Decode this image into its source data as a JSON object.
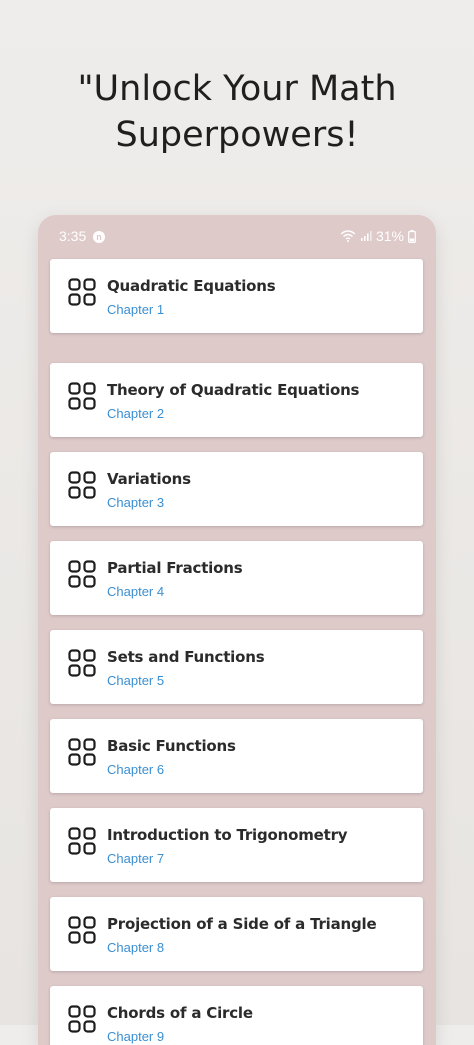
{
  "headline": {
    "line1": "\"Unlock Your Math",
    "line2": "Superpowers!"
  },
  "status": {
    "time": "3:35",
    "app_badge": "n",
    "battery": "31%"
  },
  "chapters": [
    {
      "title": "Quadratic Equations",
      "chapter": "Chapter 1"
    },
    {
      "title": "Theory of Quadratic Equations",
      "chapter": "Chapter 2"
    },
    {
      "title": "Variations",
      "chapter": "Chapter 3"
    },
    {
      "title": "Partial Fractions",
      "chapter": "Chapter 4"
    },
    {
      "title": "Sets and Functions",
      "chapter": "Chapter 5"
    },
    {
      "title": "Basic Functions",
      "chapter": "Chapter 6"
    },
    {
      "title": "Introduction to Trigonometry",
      "chapter": "Chapter 7"
    },
    {
      "title": "Projection of a Side of a Triangle",
      "chapter": "Chapter 8"
    },
    {
      "title": "Chords of a Circle",
      "chapter": "Chapter 9"
    }
  ],
  "icons": {
    "card_icon": "grid-icon",
    "wifi": "wifi-icon",
    "signal": "signal-icon",
    "battery": "battery-icon"
  }
}
